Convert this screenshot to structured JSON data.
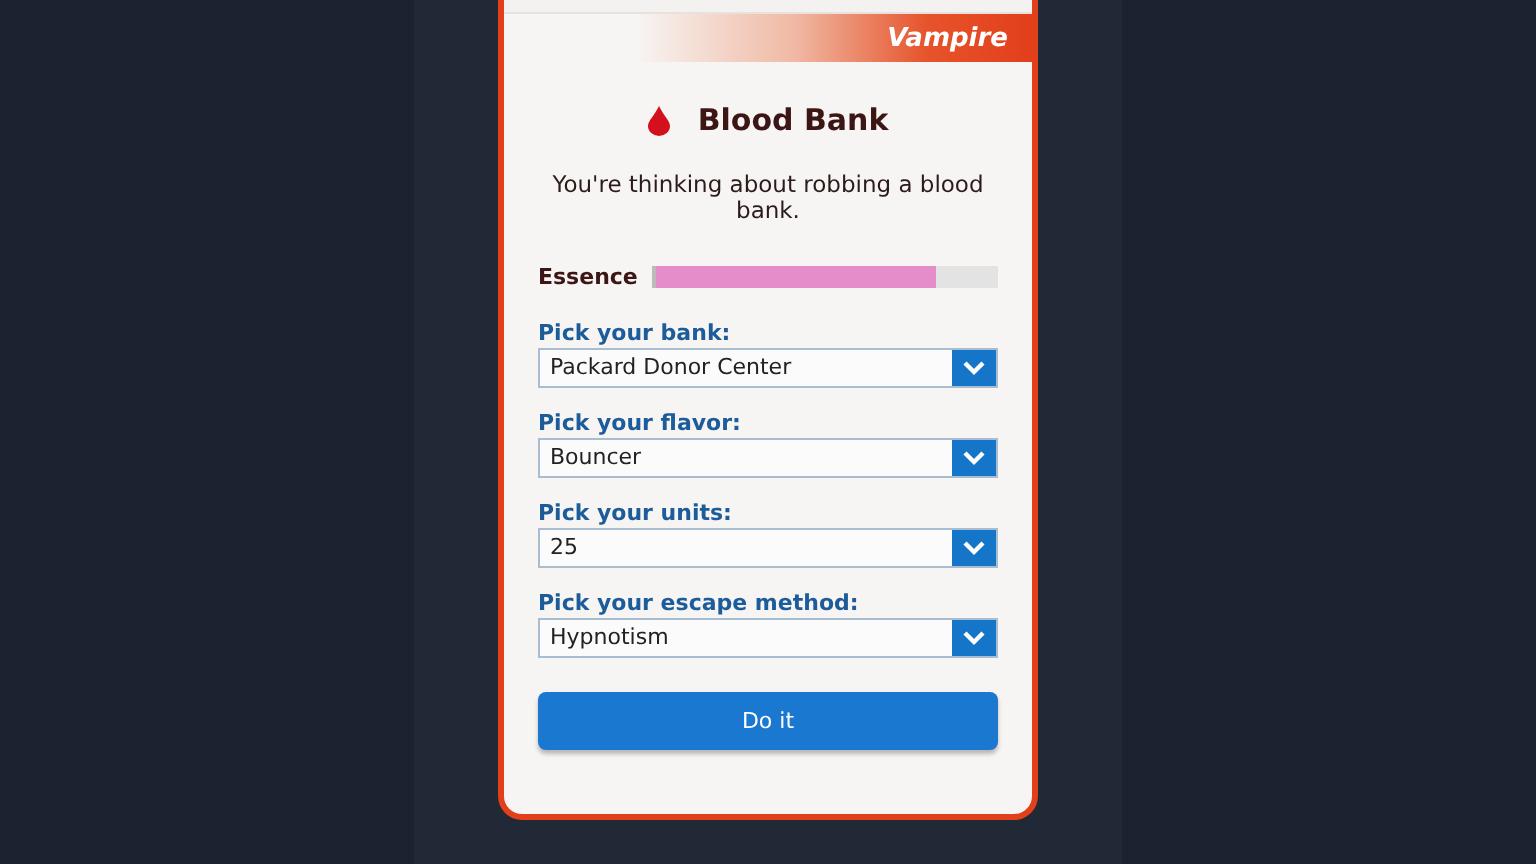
{
  "banner": {
    "label": "Vampire"
  },
  "title": "Blood Bank",
  "description": "You're thinking about robbing a blood bank.",
  "meter": {
    "label": "Essence",
    "level": 0.82
  },
  "dropdowns": [
    {
      "label": "Pick your bank:",
      "value": "Packard Donor Center"
    },
    {
      "label": "Pick your flavor:",
      "value": "Bouncer"
    },
    {
      "label": "Pick your units:",
      "value": "25"
    },
    {
      "label": "Pick your escape method:",
      "value": "Hypnotism"
    }
  ],
  "button": "Do it"
}
